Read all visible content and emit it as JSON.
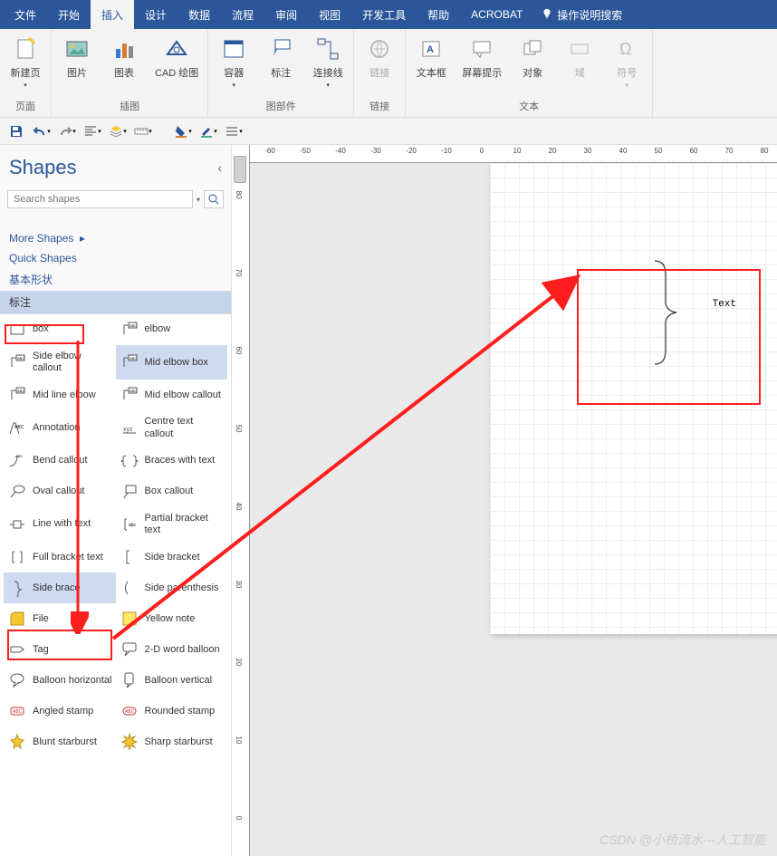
{
  "menu": {
    "items": [
      "文件",
      "开始",
      "插入",
      "设计",
      "数据",
      "流程",
      "审阅",
      "视图",
      "开发工具",
      "帮助",
      "ACROBAT"
    ],
    "active_index": 2,
    "tell_me": "操作说明搜索"
  },
  "ribbon": {
    "groups": [
      {
        "label": "页面",
        "buttons": [
          {
            "label": "新建页",
            "dd": true
          }
        ]
      },
      {
        "label": "插图",
        "buttons": [
          {
            "label": "图片"
          },
          {
            "label": "图表"
          },
          {
            "label": "CAD 绘图"
          }
        ]
      },
      {
        "label": "图部件",
        "buttons": [
          {
            "label": "容器",
            "dd": true
          },
          {
            "label": "标注"
          },
          {
            "label": "连接线",
            "dd": true
          }
        ]
      },
      {
        "label": "链接",
        "buttons": [
          {
            "label": "链接",
            "disabled": true
          }
        ]
      },
      {
        "label": "文本",
        "buttons": [
          {
            "label": "文本框"
          },
          {
            "label": "屏幕提示"
          },
          {
            "label": "对象"
          },
          {
            "label": "域",
            "disabled": true
          },
          {
            "label": "符号",
            "dd": true,
            "disabled": true
          }
        ]
      }
    ]
  },
  "panel": {
    "title": "Shapes",
    "search_placeholder": "Search shapes",
    "categories": {
      "more": "More Shapes",
      "quick": "Quick Shapes",
      "basic": "基本形状",
      "active": "标注"
    },
    "shapes_left": [
      {
        "label": "box",
        "icon": "box"
      },
      {
        "label": "Side elbow callout",
        "icon": "elbow"
      },
      {
        "label": "Mid line elbow",
        "icon": "elbow"
      },
      {
        "label": "Annotation",
        "icon": "abc"
      },
      {
        "label": "Bend callout",
        "icon": "bend"
      },
      {
        "label": "Oval callout",
        "icon": "oval"
      },
      {
        "label": "Line with text",
        "icon": "linetext"
      },
      {
        "label": "Full bracket text",
        "icon": "fullbracket"
      },
      {
        "label": "Side brace",
        "icon": "sidebrace",
        "selected": true
      },
      {
        "label": "File",
        "icon": "file"
      },
      {
        "label": "Tag",
        "icon": "tag"
      },
      {
        "label": "Balloon horizontal",
        "icon": "balloon"
      },
      {
        "label": "Angled stamp",
        "icon": "stamp"
      },
      {
        "label": "Blunt starburst",
        "icon": "star"
      }
    ],
    "shapes_right": [
      {
        "label": "elbow",
        "icon": "elbow"
      },
      {
        "label": "Mid elbow box",
        "icon": "elbow",
        "hl": true
      },
      {
        "label": "Mid elbow callout",
        "icon": "elbow"
      },
      {
        "label": "Centre text callout",
        "icon": "xyz"
      },
      {
        "label": "Braces with text",
        "icon": "braces"
      },
      {
        "label": "Box callout",
        "icon": "boxcall"
      },
      {
        "label": "Partial bracket text",
        "icon": "partial"
      },
      {
        "label": "Side bracket",
        "icon": "sidebracket"
      },
      {
        "label": "Side parenthesis",
        "icon": "sideparen"
      },
      {
        "label": "Yellow note",
        "icon": "note"
      },
      {
        "label": "2-D word balloon",
        "icon": "balloon2"
      },
      {
        "label": "Balloon vertical",
        "icon": "balloonv"
      },
      {
        "label": "Rounded stamp",
        "icon": "rstamp"
      },
      {
        "label": "Sharp starburst",
        "icon": "star2"
      }
    ]
  },
  "canvas": {
    "hruler": [
      "-60",
      "-50",
      "-40",
      "-30",
      "-20",
      "-10",
      "0",
      "10",
      "20",
      "30",
      "40",
      "50",
      "60",
      "70",
      "80"
    ],
    "vruler": [
      "80",
      "70",
      "60",
      "50",
      "40",
      "30",
      "20",
      "10",
      "0"
    ],
    "brace_text": "Text"
  },
  "watermark": "CSDN @小桥流水---人工智能"
}
